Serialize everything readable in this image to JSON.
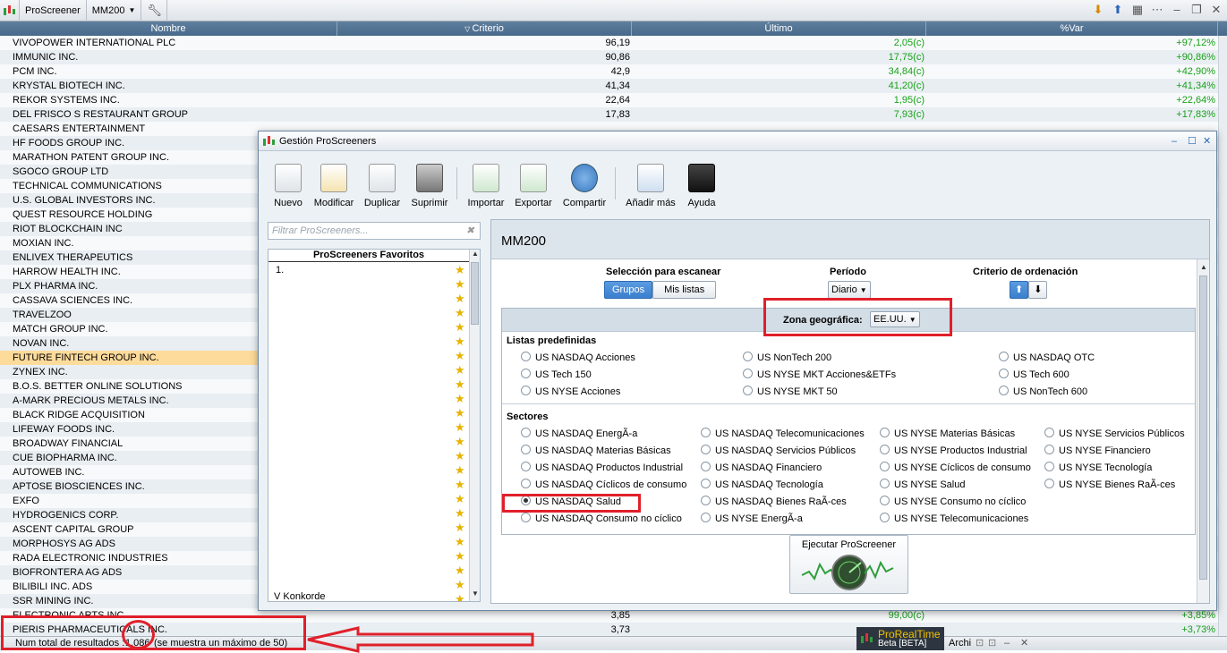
{
  "topbar": {
    "app_label": "ProScreener",
    "screener_name": "MM200"
  },
  "table": {
    "headers": {
      "name": "Nombre",
      "criterio": "Criterio",
      "ultimo": "Último",
      "var": "%Var"
    },
    "rows": [
      {
        "name": "VIVOPOWER INTERNATIONAL PLC",
        "criterio": "96,19",
        "ultimo": "2,05(c)",
        "var": "+97,12%"
      },
      {
        "name": "IMMUNIC INC.",
        "criterio": "90,86",
        "ultimo": "17,75(c)",
        "var": "+90,86%"
      },
      {
        "name": "PCM INC.",
        "criterio": "42,9",
        "ultimo": "34,84(c)",
        "var": "+42,90%"
      },
      {
        "name": "KRYSTAL BIOTECH INC.",
        "criterio": "41,34",
        "ultimo": "41,20(c)",
        "var": "+41,34%"
      },
      {
        "name": "REKOR SYSTEMS INC.",
        "criterio": "22,64",
        "ultimo": "1,95(c)",
        "var": "+22,64%"
      },
      {
        "name": "DEL FRISCO S RESTAURANT GROUP",
        "criterio": "17,83",
        "ultimo": "7,93(c)",
        "var": "+17,83%"
      },
      {
        "name": "CAESARS ENTERTAINMENT",
        "criterio": "",
        "ultimo": "",
        "var": ""
      },
      {
        "name": "HF FOODS GROUP INC.",
        "criterio": "",
        "ultimo": "",
        "var": ""
      },
      {
        "name": "MARATHON PATENT GROUP INC.",
        "criterio": "",
        "ultimo": "",
        "var": ""
      },
      {
        "name": "SGOCO GROUP LTD",
        "criterio": "",
        "ultimo": "",
        "var": ""
      },
      {
        "name": "TECHNICAL COMMUNICATIONS",
        "criterio": "",
        "ultimo": "",
        "var": ""
      },
      {
        "name": "U.S. GLOBAL INVESTORS INC.",
        "criterio": "",
        "ultimo": "",
        "var": ""
      },
      {
        "name": "QUEST RESOURCE HOLDING",
        "criterio": "",
        "ultimo": "",
        "var": ""
      },
      {
        "name": "RIOT BLOCKCHAIN INC",
        "criterio": "",
        "ultimo": "",
        "var": ""
      },
      {
        "name": "MOXIAN INC.",
        "criterio": "",
        "ultimo": "",
        "var": ""
      },
      {
        "name": "ENLIVEX THERAPEUTICS",
        "criterio": "",
        "ultimo": "",
        "var": ""
      },
      {
        "name": "HARROW HEALTH INC.",
        "criterio": "",
        "ultimo": "",
        "var": ""
      },
      {
        "name": "PLX PHARMA INC.",
        "criterio": "",
        "ultimo": "",
        "var": ""
      },
      {
        "name": "CASSAVA SCIENCES INC.",
        "criterio": "",
        "ultimo": "",
        "var": ""
      },
      {
        "name": "TRAVELZOO",
        "criterio": "",
        "ultimo": "",
        "var": ""
      },
      {
        "name": "MATCH GROUP INC.",
        "criterio": "",
        "ultimo": "",
        "var": ""
      },
      {
        "name": "NOVAN INC.",
        "criterio": "",
        "ultimo": "",
        "var": ""
      },
      {
        "name": "FUTURE FINTECH GROUP INC.",
        "criterio": "",
        "ultimo": "",
        "var": "",
        "selected": true
      },
      {
        "name": "ZYNEX INC.",
        "criterio": "",
        "ultimo": "",
        "var": ""
      },
      {
        "name": "B.O.S. BETTER ONLINE SOLUTIONS",
        "criterio": "",
        "ultimo": "",
        "var": ""
      },
      {
        "name": "A-MARK PRECIOUS METALS INC.",
        "criterio": "",
        "ultimo": "",
        "var": ""
      },
      {
        "name": "BLACK RIDGE ACQUISITION",
        "criterio": "",
        "ultimo": "",
        "var": ""
      },
      {
        "name": "LIFEWAY FOODS INC.",
        "criterio": "",
        "ultimo": "",
        "var": ""
      },
      {
        "name": "BROADWAY FINANCIAL",
        "criterio": "",
        "ultimo": "",
        "var": ""
      },
      {
        "name": "CUE BIOPHARMA INC.",
        "criterio": "",
        "ultimo": "",
        "var": ""
      },
      {
        "name": "AUTOWEB INC.",
        "criterio": "",
        "ultimo": "",
        "var": ""
      },
      {
        "name": "APTOSE BIOSCIENCES INC.",
        "criterio": "",
        "ultimo": "",
        "var": ""
      },
      {
        "name": "EXFO",
        "criterio": "",
        "ultimo": "",
        "var": ""
      },
      {
        "name": "HYDROGENICS CORP.",
        "criterio": "",
        "ultimo": "",
        "var": ""
      },
      {
        "name": "ASCENT CAPITAL GROUP",
        "criterio": "",
        "ultimo": "",
        "var": ""
      },
      {
        "name": "MORPHOSYS AG ADS",
        "criterio": "",
        "ultimo": "",
        "var": ""
      },
      {
        "name": "RADA ELECTRONIC INDUSTRIES",
        "criterio": "",
        "ultimo": "",
        "var": ""
      },
      {
        "name": "BIOFRONTERA AG ADS",
        "criterio": "",
        "ultimo": "",
        "var": ""
      },
      {
        "name": "BILIBILI INC. ADS",
        "criterio": "",
        "ultimo": "",
        "var": ""
      },
      {
        "name": "SSR MINING INC.",
        "criterio": "",
        "ultimo": "",
        "var": ""
      },
      {
        "name": "ELECTRONIC ARTS INC.",
        "criterio": "3,85",
        "ultimo": "99,00(c)",
        "var": "+3,85%"
      },
      {
        "name": "PIERIS PHARMACEUTICALS INC.",
        "criterio": "3,73",
        "ultimo": "",
        "var": "+3,73%"
      }
    ]
  },
  "status": {
    "label": "Num total de resultados :",
    "count": "1.086",
    "note": "(se muestra un máximo de 50)",
    "prt_title": "ProRealTime",
    "prt_sub": "Beta [BETA]",
    "archi": "Archi"
  },
  "dialog": {
    "title": "Gestión ProScreeners",
    "toolbar": [
      "Nuevo",
      "Modificar",
      "Duplicar",
      "Suprimir",
      "Importar",
      "Exportar",
      "Compartir",
      "Añadir más",
      "Ayuda"
    ],
    "filter_placeholder": "Filtrar ProScreeners...",
    "favorites_header": "ProScreeners Favoritos",
    "favorites_first": "1.",
    "favorites_last": "V Konkorde",
    "screener_title": "MM200",
    "seleccion_label": "Selección para escanear",
    "grupos": "Grupos",
    "mis_listas": "Mis listas",
    "periodo_label": "Período",
    "periodo_value": "Diario",
    "criterio_label": "Criterio de ordenación",
    "zona_label": "Zona geográfica:",
    "zona_value": "EE.UU.",
    "listas_label": "Listas predefinidas",
    "listas": [
      "US NASDAQ Acciones",
      "US NonTech 200",
      "US NASDAQ OTC",
      "US Tech 150",
      "US NYSE MKT Acciones&ETFs",
      "US Tech 600",
      "US NYSE Acciones",
      "US NYSE MKT 50",
      "US NonTech 600"
    ],
    "sectores_label": "Sectores",
    "sectores": [
      [
        "US NASDAQ EnergÃ-a",
        "US NASDAQ Telecomunicaciones",
        "US NYSE Materias Básicas",
        "US NYSE Servicios Públicos"
      ],
      [
        "US NASDAQ Materias Básicas",
        "US NASDAQ Servicios Públicos",
        "US NYSE Productos Industrial",
        "US NYSE Financiero"
      ],
      [
        "US NASDAQ Productos Industrial",
        "US NASDAQ Financiero",
        "US NYSE Cíclicos de consumo",
        "US NYSE Tecnología"
      ],
      [
        "US NASDAQ Cíclicos de consumo",
        "US NASDAQ Tecnología",
        "US NYSE Salud",
        "US NYSE Bienes RaÃ-ces"
      ],
      [
        "US NASDAQ Salud",
        "US NASDAQ Bienes RaÃ-ces",
        "US NYSE Consumo no cíclico",
        ""
      ],
      [
        "US NASDAQ Consumo no cíclico",
        "US NYSE EnergÃ-a",
        "US NYSE Telecomunicaciones",
        ""
      ]
    ],
    "selected_sector": "US NASDAQ Salud",
    "run_button": "Ejecutar ProScreener"
  },
  "colors": {
    "accent": "#3a7fce",
    "positive": "#17a117",
    "selected_row": "#fddb9a",
    "annotation": "#e0202a"
  }
}
